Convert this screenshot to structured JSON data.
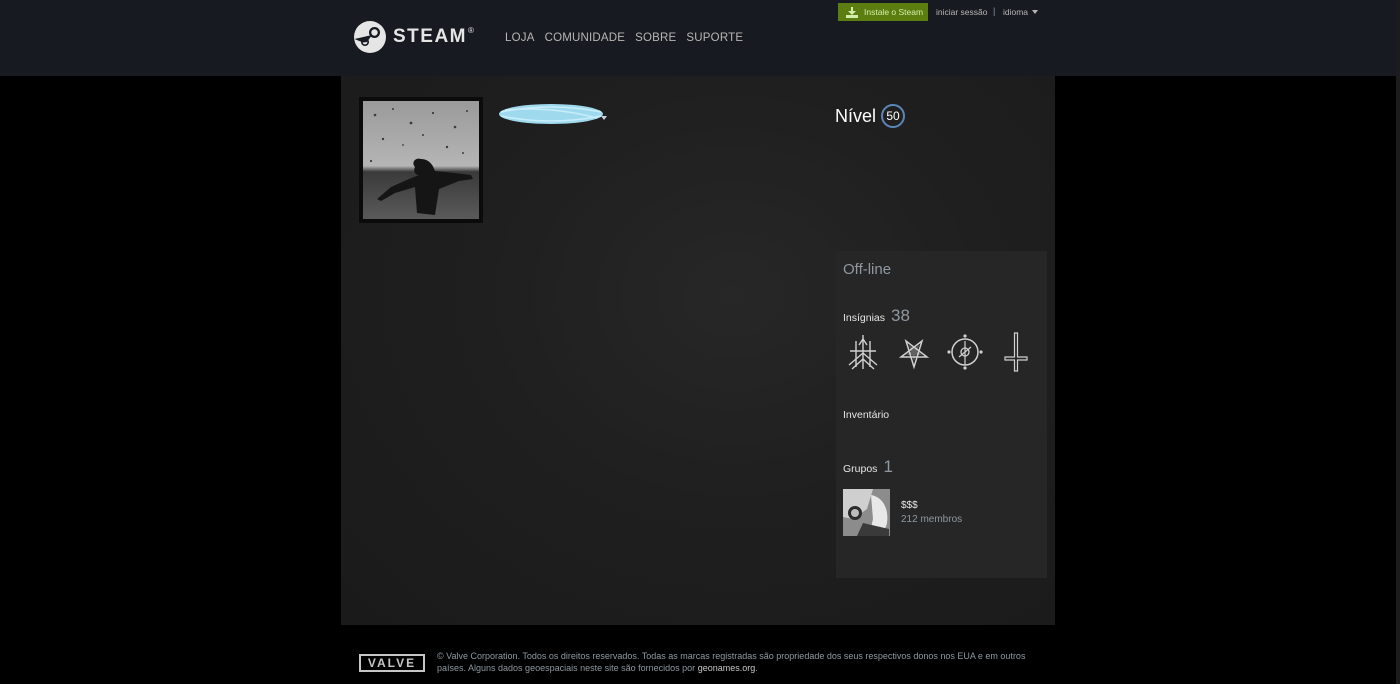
{
  "header": {
    "brand": "STEAM",
    "brand_mark": "®",
    "nav": [
      "LOJA",
      "COMUNIDADE",
      "SOBRE",
      "SUPORTE"
    ],
    "install_label": "Instale o Steam",
    "login_label": "iniciar sessão",
    "separator": "|",
    "language_label": "idioma"
  },
  "profile": {
    "level_label": "Nível",
    "level_value": "50",
    "status": "Off-line",
    "badges_label": "Insígnias",
    "badges_count": "38",
    "badge_icons": [
      "sigil-badge-icon",
      "pentagram-badge-icon",
      "occult-circle-badge-icon",
      "inverted-cross-badge-icon"
    ],
    "inventory_label": "Inventário",
    "groups_label": "Grupos",
    "groups_count": "1",
    "group": {
      "name": "$$$",
      "members": "212 membros"
    }
  },
  "footer": {
    "valve": "VALVE",
    "legal_text": "© Valve Corporation. Todos os direitos reservados. Todas as marcas registradas são propriedade dos seus respectivos donos nos EUA e em outros países. Alguns dados geoespaciais neste site são fornecidos por",
    "geonames_link": "geonames.org",
    "legal_end": "."
  },
  "colors": {
    "header_bg": "#171a21",
    "install_green": "#5c7e10",
    "panel_bg": "#1f1f1f",
    "sidebar_bg": "#262626",
    "level_ring": "#5b86b5",
    "name_scribble": "#9fd9ee"
  }
}
